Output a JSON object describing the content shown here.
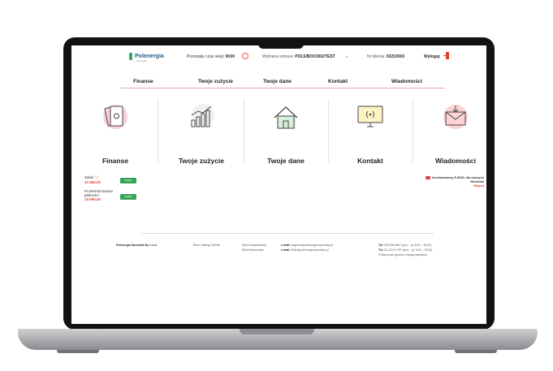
{
  "header": {
    "logo": "Polenergia",
    "logo_sub": "Sprzedaż",
    "session_label": "Pozostały czas sesji:",
    "session_time": "9h59",
    "contract_label": "Wybrana umowa:",
    "contract_value": "POL5/BOC/002/TEST",
    "client_label": "Nr klienta:",
    "client_value": "03210003",
    "logout": "Wyloguj"
  },
  "nav": [
    "Finanse",
    "Twoje zużycie",
    "Twoje dane",
    "Kontakt",
    "Wiadomości"
  ],
  "tiles": [
    {
      "label": "Finanse",
      "icon": "money-icon"
    },
    {
      "label": "Twoje zużycie",
      "icon": "chart-icon"
    },
    {
      "label": "Twoje dane",
      "icon": "house-icon"
    },
    {
      "label": "Kontakt",
      "icon": "monitor-icon"
    },
    {
      "label": "Wiadomości",
      "icon": "envelope-icon"
    }
  ],
  "balance": {
    "label": "Saldo",
    "value": "13 550,00",
    "overdue_label": "Przeterminowane płatności",
    "overdue_value": "13 550,00",
    "pay_button": "Zapłać"
  },
  "message": {
    "text": "Uruchamiamy E-BOK dla naszych Klientów",
    "more": "Więcej"
  },
  "footer": {
    "company": "Polenergia Sprzedaż Sp. z o.o.",
    "office": "Biuro Obsługi Klienta",
    "client_individual": "Klient indywidualny:",
    "client_business": "Klient biznesowy:",
    "email1_label": "e-mail:",
    "email1": "bogreen@polenergia-sprzedaz.pl",
    "email2_label": "e-mail:",
    "email2": "BOK@polenergia-sprzedaz.pl",
    "tel1_label": "Tel:",
    "tel1": "029 605 660* (pon. - pt. 8:00 – 18:00)",
    "tel2_label": "Tel:",
    "tel2": "22 129 17 50* (pon. - pt. 9:00 – 15:00)",
    "note": "*Połączenia zgodnie z taryfą operatora"
  },
  "colors": {
    "accent": "#e0403a",
    "brand": "#2fae63",
    "pay": "#3aa357"
  }
}
